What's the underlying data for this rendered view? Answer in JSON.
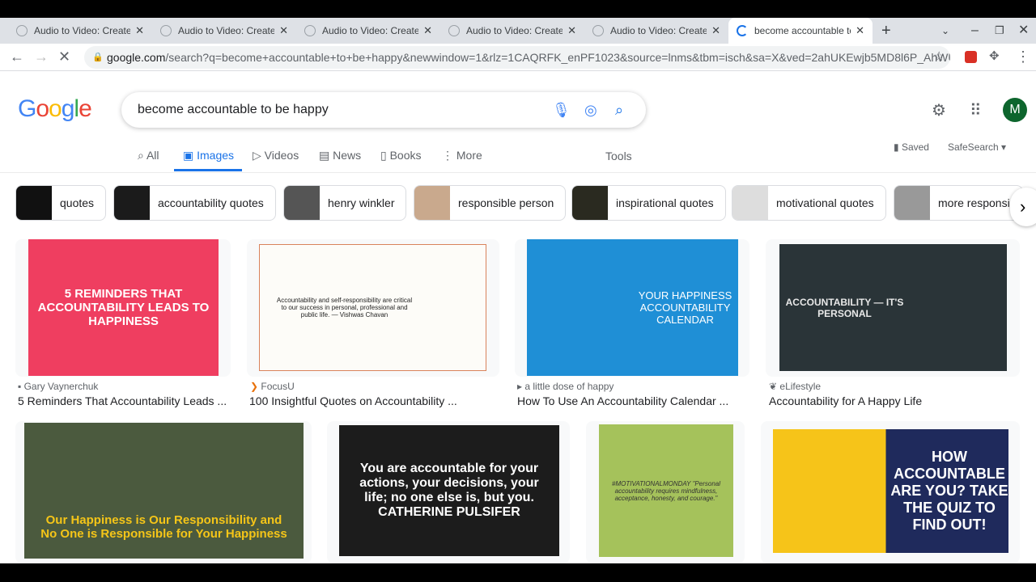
{
  "tabs": [
    {
      "label": "Audio to Video: Create"
    },
    {
      "label": "Audio to Video: Create"
    },
    {
      "label": "Audio to Video: Create"
    },
    {
      "label": "Audio to Video: Create"
    },
    {
      "label": "Audio to Video: Create"
    },
    {
      "label": "become accountable to"
    }
  ],
  "address": {
    "domain": "google.com",
    "path": "/search?q=become+accountable+to+be+happy&newwindow=1&rlz=1CAQRFK_enPF1023&source=lnms&tbm=isch&sa=X&ved=2ahUKEwjb5MD8l6P_AhWUOU..."
  },
  "logo": "Google",
  "search": {
    "query": "become accountable to be happy"
  },
  "avatar": "M",
  "menu": {
    "all": "All",
    "images": "Images",
    "videos": "Videos",
    "news": "News",
    "books": "Books",
    "more": "More",
    "tools": "Tools",
    "saved": "Saved",
    "safesearch": "SafeSearch"
  },
  "chips": [
    "quotes",
    "accountability quotes",
    "henry winkler",
    "responsible person",
    "inspirational quotes",
    "motivational quotes",
    "more responsi"
  ],
  "results": [
    {
      "source": "Gary Vaynerchuk",
      "title": "5 Reminders That Accountability Leads ...",
      "image_text": "5 REMINDERS THAT ACCOUNTABILITY LEADS TO HAPPINESS"
    },
    {
      "source": "FocusU",
      "title": "100 Insightful Quotes on Accountability ...",
      "image_text": "Accountability and self-responsibility are critical to our success in personal, professional and public life. — Vishwas Chavan"
    },
    {
      "source": "a little dose of happy",
      "title": "How To Use An Accountability Calendar ...",
      "image_text": "YOUR HAPPINESS ACCOUNTABILITY CALENDAR"
    },
    {
      "source": "eLifestyle",
      "title": "Accountability for A Happy Life",
      "image_text": "ACCOUNTABILITY — IT'S PERSONAL"
    },
    {
      "image_text": "Our Happiness is Our Responsibility and No One is Responsible for Your Happiness"
    },
    {
      "image_text": "You are accountable for your actions, your decisions, your life; no one else is, but you. CATHERINE PULSIFER"
    },
    {
      "image_text": "#MOTIVATIONALMONDAY \"Personal accountability requires mindfulness, acceptance, honesty, and courage.\""
    },
    {
      "image_text": "HOW ACCOUNTABLE ARE YOU? TAKE THE QUIZ TO FIND OUT!"
    }
  ]
}
